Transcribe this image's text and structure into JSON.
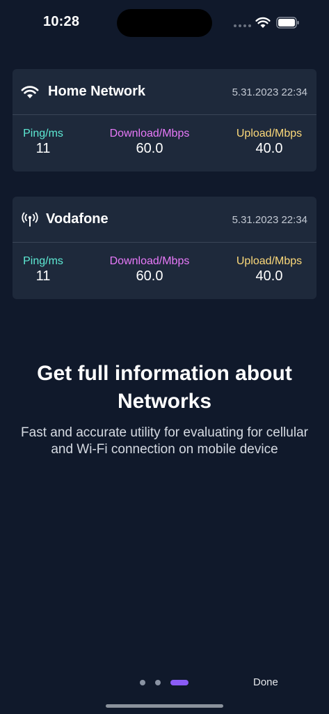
{
  "status_bar": {
    "time": "10:28"
  },
  "cards": [
    {
      "name": "Home Network",
      "type_icon": "wifi-icon",
      "date": "5.31.2023 22:34",
      "ping_label": "Ping/ms",
      "ping_value": "11",
      "download_label": "Download/Mbps",
      "download_value": "60.0",
      "upload_label": "Upload/Mbps",
      "upload_value": "40.0"
    },
    {
      "name": "Vodafone",
      "type_icon": "cellular-antenna-icon",
      "date": "5.31.2023 22:34",
      "ping_label": "Ping/ms",
      "ping_value": "11",
      "download_label": "Download/Mbps",
      "download_value": "60.0",
      "upload_label": "Upload/Mbps",
      "upload_value": "40.0"
    }
  ],
  "onboarding": {
    "headline": "Get full information about Networks",
    "subtitle": "Fast and accurate utility for evaluating for cellular and Wi-Fi connection on mobile device"
  },
  "pager": {
    "pages": 3,
    "current_page": 3
  },
  "done_label": "Done",
  "colors": {
    "background": "#10192b",
    "card": "#1e293b",
    "ping": "#5eead4",
    "download": "#e879f9",
    "upload": "#fcd97a",
    "accent": "#8b5cf6"
  }
}
